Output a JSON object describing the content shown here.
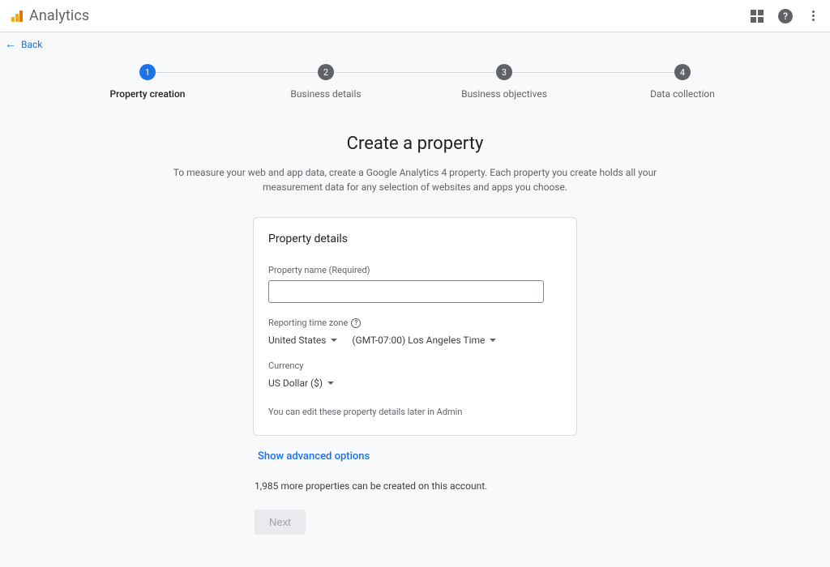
{
  "header": {
    "app_title": "Analytics",
    "back_label": "Back"
  },
  "stepper": {
    "steps": [
      {
        "num": "1",
        "label": "Property creation"
      },
      {
        "num": "2",
        "label": "Business details"
      },
      {
        "num": "3",
        "label": "Business objectives"
      },
      {
        "num": "4",
        "label": "Data collection"
      }
    ]
  },
  "page": {
    "title": "Create a property",
    "description": "To measure your web and app data, create a Google Analytics 4 property. Each property you create holds all your measurement data for any selection of websites and apps you choose."
  },
  "card": {
    "title": "Property details",
    "property_name_label": "Property name (Required)",
    "property_name_value": "",
    "timezone_label": "Reporting time zone",
    "timezone_country": "United States",
    "timezone_value": "(GMT-07:00) Los Angeles Time",
    "currency_label": "Currency",
    "currency_value": "US Dollar ($)",
    "edit_hint": "You can edit these property details later in Admin"
  },
  "below": {
    "advanced_label": "Show advanced options",
    "count_text": "1,985 more properties can be created on this account.",
    "next_label": "Next"
  }
}
